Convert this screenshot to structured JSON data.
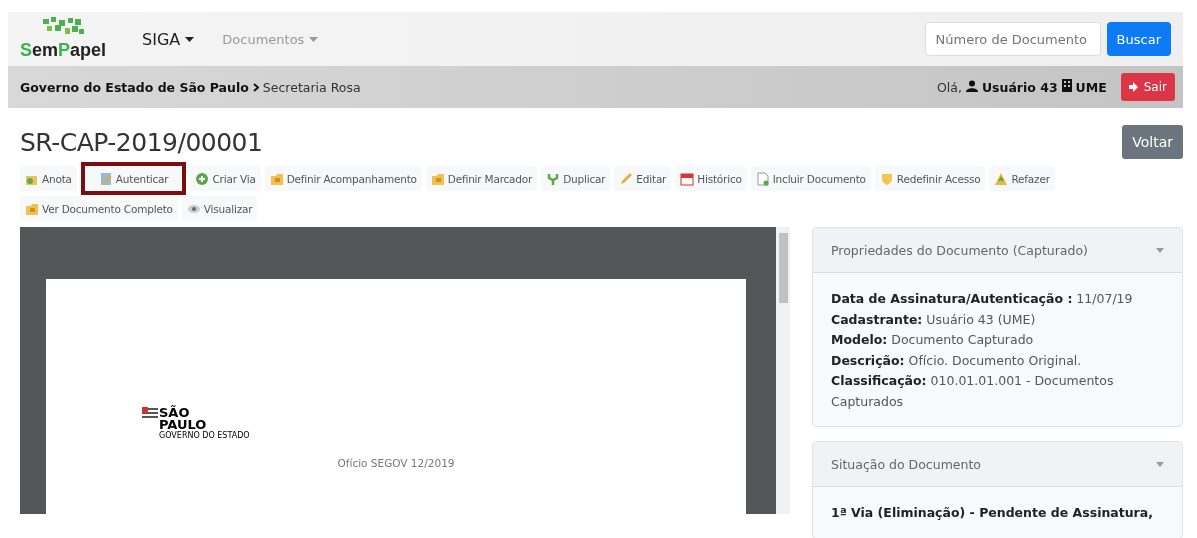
{
  "navbar": {
    "brand": "SemPapel",
    "menus": [
      {
        "label": "SIGA",
        "kind": "primary"
      },
      {
        "label": "Documentos",
        "kind": "muted"
      }
    ],
    "search": {
      "placeholder": "Número de Documento"
    },
    "search_button": "Buscar"
  },
  "breadcrumb": {
    "parts": [
      "Governo do Estado de São Paulo",
      "Secretaria Rosa"
    ],
    "greeting": "Olá,",
    "user": "Usuário 43",
    "unit": "UME",
    "logout": "Sair"
  },
  "title": "SR-CAP-2019/00001",
  "back_button": "Voltar",
  "actions": [
    {
      "label": "Anota",
      "kind": "note",
      "highlighted": false
    },
    {
      "label": "Autenticar",
      "kind": "stamp",
      "highlighted": true
    },
    {
      "label": "Criar Via",
      "kind": "plus",
      "highlighted": false
    },
    {
      "label": "Definir Acompanhamento",
      "kind": "folder",
      "highlighted": false
    },
    {
      "label": "Definir Marcador",
      "kind": "folder",
      "highlighted": false
    },
    {
      "label": "Duplicar",
      "kind": "fork",
      "highlighted": false
    },
    {
      "label": "Editar",
      "kind": "pencil",
      "highlighted": false
    },
    {
      "label": "Histórico",
      "kind": "calendar",
      "highlighted": false
    },
    {
      "label": "Incluir Documento",
      "kind": "page",
      "highlighted": false
    },
    {
      "label": "Redefinir Acesso",
      "kind": "shield",
      "highlighted": false
    },
    {
      "label": "Refazer",
      "kind": "triangle",
      "highlighted": false
    },
    {
      "label": "Ver Documento Completo",
      "kind": "folder",
      "highlighted": false
    },
    {
      "label": "Visualizar",
      "kind": "eye",
      "highlighted": false
    }
  ],
  "document": {
    "logo_lines": [
      "SÃO",
      "PAULO",
      "GOVERNO DO ESTADO"
    ],
    "heading": "Ofício SEGOV 12/2019"
  },
  "panels": [
    {
      "title": "Propriedades do Documento (Capturado)",
      "lines": [
        "**Data de Assinatura/Autenticação :** 11/07/19",
        "**Cadastrante:** Usuário 43 (UME)",
        "**Modelo:** Documento Capturado",
        "**Descrição:** Ofício. Documento Original.",
        "**Classificação:** 010.01.01.001 - Documentos Capturados"
      ]
    },
    {
      "title": "Situação do Documento",
      "lines": [
        "**1ª Via (Eliminação) - Pendente de Assinatura,**"
      ]
    }
  ]
}
